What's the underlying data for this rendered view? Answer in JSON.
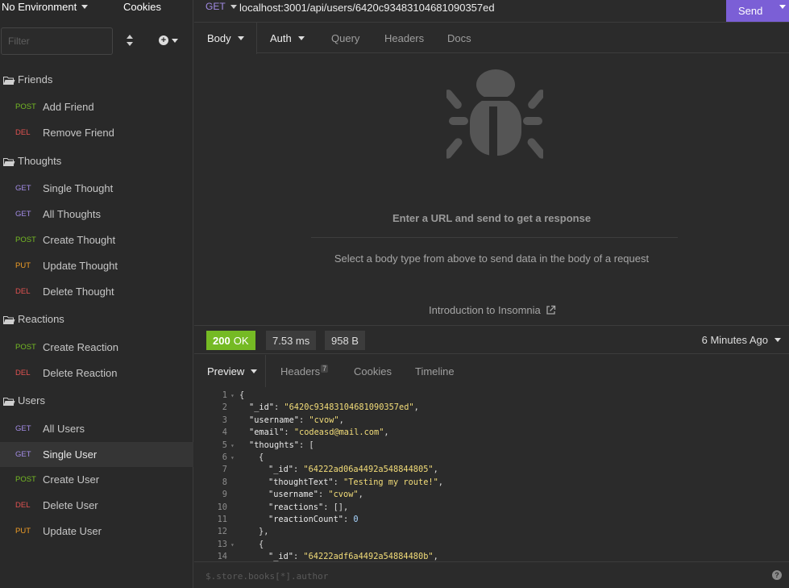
{
  "sidebar": {
    "environment": "No Environment",
    "cookies_label": "Cookies",
    "filter_placeholder": "Filter",
    "folders": [
      {
        "label": "Friends"
      },
      {
        "label": "Thoughts"
      },
      {
        "label": "Reactions"
      },
      {
        "label": "Users"
      }
    ],
    "requests": [
      {
        "method": "POST",
        "label": "Add Friend"
      },
      {
        "method": "DEL",
        "label": "Remove Friend"
      },
      {
        "method": "GET",
        "label": "Single Thought"
      },
      {
        "method": "GET",
        "label": "All Thoughts"
      },
      {
        "method": "POST",
        "label": "Create Thought"
      },
      {
        "method": "PUT",
        "label": "Update Thought"
      },
      {
        "method": "DEL",
        "label": "Delete Thought"
      },
      {
        "method": "POST",
        "label": "Create Reaction"
      },
      {
        "method": "DEL",
        "label": "Delete Reaction"
      },
      {
        "method": "GET",
        "label": "All Users"
      },
      {
        "method": "GET",
        "label": "Single User"
      },
      {
        "method": "POST",
        "label": "Create User"
      },
      {
        "method": "DEL",
        "label": "Delete User"
      },
      {
        "method": "PUT",
        "label": "Update User"
      }
    ]
  },
  "request": {
    "method": "GET",
    "url": "localhost:3001/api/users/6420c93483104681090357ed",
    "send_label": "Send",
    "tabs": {
      "body": "Body",
      "auth": "Auth",
      "query": "Query",
      "headers": "Headers",
      "docs": "Docs"
    }
  },
  "empty_state": {
    "title": "Enter a URL and send to get a response",
    "subtitle": "Select a body type from above to send data in the body of a request",
    "link": "Introduction to Insomnia"
  },
  "response": {
    "status_code": "200",
    "status_text": "OK",
    "time": "7.53 ms",
    "size": "958 B",
    "history": "6 Minutes Ago",
    "tabs": {
      "preview": "Preview",
      "headers": "Headers",
      "headers_count": "7",
      "cookies": "Cookies",
      "timeline": "Timeline"
    },
    "lines": [
      {
        "n": "1",
        "fold": true,
        "indent": 0,
        "parts": [
          {
            "t": "{",
            "c": "p"
          }
        ]
      },
      {
        "n": "2",
        "fold": false,
        "indent": 1,
        "parts": [
          {
            "t": "\"_id\"",
            "c": "k"
          },
          {
            "t": ": ",
            "c": "p"
          },
          {
            "t": "\"6420c93483104681090357ed\"",
            "c": "s"
          },
          {
            "t": ",",
            "c": "p"
          }
        ]
      },
      {
        "n": "3",
        "fold": false,
        "indent": 1,
        "parts": [
          {
            "t": "\"username\"",
            "c": "k"
          },
          {
            "t": ": ",
            "c": "p"
          },
          {
            "t": "\"cvow\"",
            "c": "s"
          },
          {
            "t": ",",
            "c": "p"
          }
        ]
      },
      {
        "n": "4",
        "fold": false,
        "indent": 1,
        "parts": [
          {
            "t": "\"email\"",
            "c": "k"
          },
          {
            "t": ": ",
            "c": "p"
          },
          {
            "t": "\"codeasd@mail.com\"",
            "c": "s"
          },
          {
            "t": ",",
            "c": "p"
          }
        ]
      },
      {
        "n": "5",
        "fold": true,
        "indent": 1,
        "parts": [
          {
            "t": "\"thoughts\"",
            "c": "k"
          },
          {
            "t": ": [",
            "c": "p"
          }
        ]
      },
      {
        "n": "6",
        "fold": true,
        "indent": 2,
        "parts": [
          {
            "t": "{",
            "c": "p"
          }
        ]
      },
      {
        "n": "7",
        "fold": false,
        "indent": 3,
        "parts": [
          {
            "t": "\"_id\"",
            "c": "k"
          },
          {
            "t": ": ",
            "c": "p"
          },
          {
            "t": "\"64222ad06a4492a548844805\"",
            "c": "s"
          },
          {
            "t": ",",
            "c": "p"
          }
        ]
      },
      {
        "n": "8",
        "fold": false,
        "indent": 3,
        "parts": [
          {
            "t": "\"thoughtText\"",
            "c": "k"
          },
          {
            "t": ": ",
            "c": "p"
          },
          {
            "t": "\"Testing my route!\"",
            "c": "s"
          },
          {
            "t": ",",
            "c": "p"
          }
        ]
      },
      {
        "n": "9",
        "fold": false,
        "indent": 3,
        "parts": [
          {
            "t": "\"username\"",
            "c": "k"
          },
          {
            "t": ": ",
            "c": "p"
          },
          {
            "t": "\"cvow\"",
            "c": "s"
          },
          {
            "t": ",",
            "c": "p"
          }
        ]
      },
      {
        "n": "10",
        "fold": false,
        "indent": 3,
        "parts": [
          {
            "t": "\"reactions\"",
            "c": "k"
          },
          {
            "t": ": [],",
            "c": "p"
          }
        ]
      },
      {
        "n": "11",
        "fold": false,
        "indent": 3,
        "parts": [
          {
            "t": "\"reactionCount\"",
            "c": "k"
          },
          {
            "t": ": ",
            "c": "p"
          },
          {
            "t": "0",
            "c": "n"
          }
        ]
      },
      {
        "n": "12",
        "fold": false,
        "indent": 2,
        "parts": [
          {
            "t": "},",
            "c": "p"
          }
        ]
      },
      {
        "n": "13",
        "fold": true,
        "indent": 2,
        "parts": [
          {
            "t": "{",
            "c": "p"
          }
        ]
      },
      {
        "n": "14",
        "fold": false,
        "indent": 3,
        "parts": [
          {
            "t": "\"_id\"",
            "c": "k"
          },
          {
            "t": ": ",
            "c": "p"
          },
          {
            "t": "\"64222adf6a4492a54884480b\"",
            "c": "s"
          },
          {
            "t": ",",
            "c": "p"
          }
        ]
      }
    ],
    "filter_placeholder": "$.store.books[*].author"
  },
  "colors": {
    "accent": "#7b5fd6",
    "ok": "#75ba24",
    "post": "#75ba24",
    "get": "#a38ce6",
    "del": "#e15251",
    "put": "#ee9c26"
  }
}
